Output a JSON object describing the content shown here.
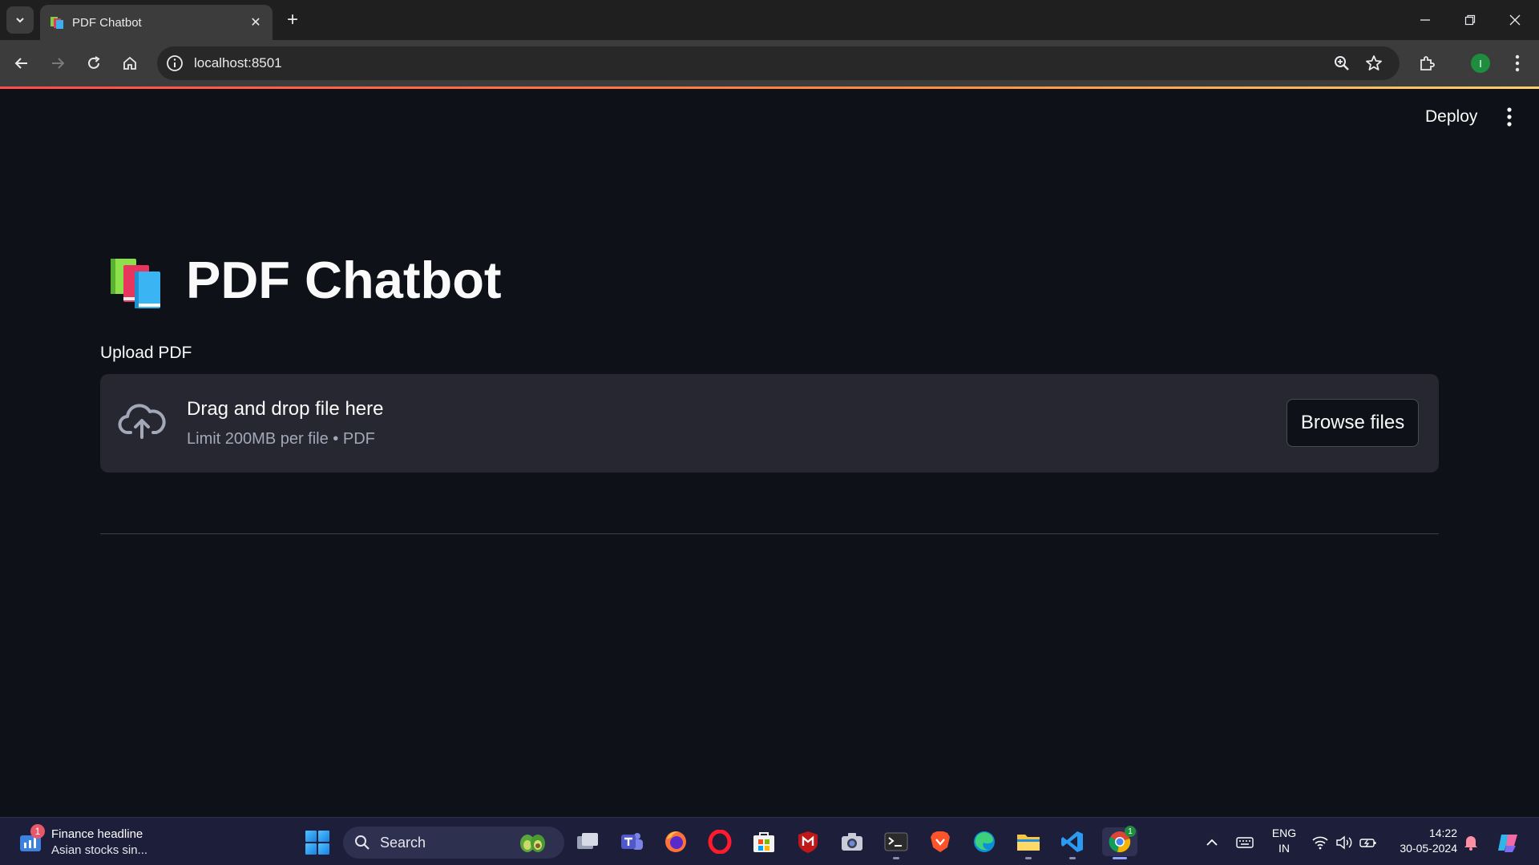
{
  "browser": {
    "tab_title": "PDF Chatbot",
    "url": "localhost:8501",
    "profile_initial": "I"
  },
  "app": {
    "deploy_label": "Deploy",
    "title": "PDF Chatbot",
    "upload_label": "Upload PDF",
    "dropzone_title": "Drag and drop file here",
    "dropzone_subtitle": "Limit 200MB per file • PDF",
    "browse_label": "Browse files"
  },
  "taskbar": {
    "news_badge": "1",
    "news_title": "Finance headline",
    "news_subtitle": "Asian stocks sin...",
    "search_placeholder": "Search",
    "lang_line1": "ENG",
    "lang_line2": "IN",
    "time": "14:22",
    "date": "30-05-2024",
    "chrome_badge": "1"
  },
  "colors": {
    "app_bg": "#0e1117",
    "dropzone_bg": "#262730",
    "accent": "#ff4b4b",
    "taskbar_bg": "#1d1e3a"
  }
}
